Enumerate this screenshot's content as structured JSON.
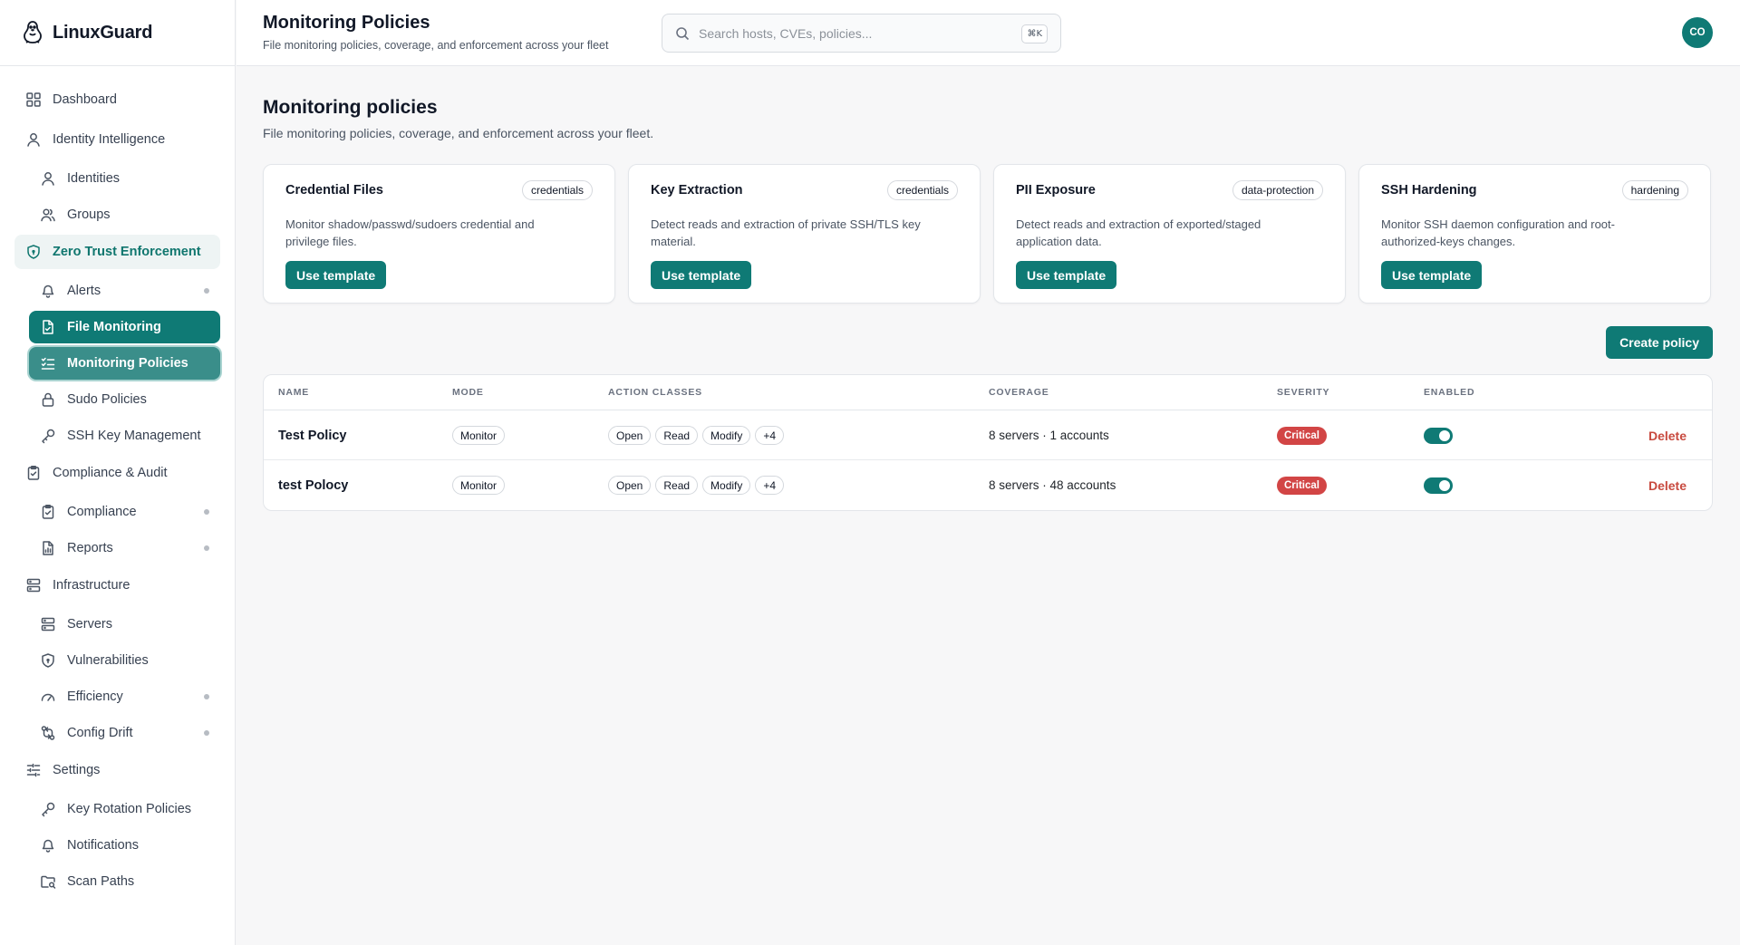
{
  "app": {
    "name": "LinuxGuard"
  },
  "sidebar": {
    "items": [
      {
        "label": "Dashboard",
        "icon": "dashboard-icon",
        "level": "top"
      },
      {
        "label": "Identity Intelligence",
        "icon": "user-icon",
        "level": "top"
      },
      {
        "label": "Identities",
        "icon": "user-icon",
        "level": "sub"
      },
      {
        "label": "Groups",
        "icon": "users-icon",
        "level": "sub"
      },
      {
        "label": "Zero Trust Enforcement",
        "icon": "shield-icon",
        "level": "top",
        "state": "section-active"
      },
      {
        "label": "Alerts",
        "icon": "bell-icon",
        "level": "sub",
        "dot": true
      },
      {
        "label": "File Monitoring",
        "icon": "file-icon",
        "level": "sub",
        "state": "active"
      },
      {
        "label": "Monitoring Policies",
        "icon": "list-check-icon",
        "level": "sub",
        "state": "active2"
      },
      {
        "label": "Sudo Policies",
        "icon": "lock-icon",
        "level": "sub"
      },
      {
        "label": "SSH Key Management",
        "icon": "key-icon",
        "level": "sub"
      },
      {
        "label": "Compliance & Audit",
        "icon": "clipboard-icon",
        "level": "top"
      },
      {
        "label": "Compliance",
        "icon": "clipboard-icon",
        "level": "sub",
        "dot": true
      },
      {
        "label": "Reports",
        "icon": "report-icon",
        "level": "sub",
        "dot": true
      },
      {
        "label": "Infrastructure",
        "icon": "server-icon",
        "level": "top"
      },
      {
        "label": "Servers",
        "icon": "server-icon",
        "level": "sub"
      },
      {
        "label": "Vulnerabilities",
        "icon": "shield-icon",
        "level": "sub"
      },
      {
        "label": "Efficiency",
        "icon": "gauge-icon",
        "level": "sub",
        "dot": true
      },
      {
        "label": "Config Drift",
        "icon": "git-compare-icon",
        "level": "sub",
        "dot": true
      },
      {
        "label": "Settings",
        "icon": "sliders-icon",
        "level": "top"
      },
      {
        "label": "Key Rotation Policies",
        "icon": "key-icon",
        "level": "sub"
      },
      {
        "label": "Notifications",
        "icon": "bell-icon",
        "level": "sub"
      },
      {
        "label": "Scan Paths",
        "icon": "folder-search-icon",
        "level": "sub"
      }
    ]
  },
  "header": {
    "title": "Monitoring Policies",
    "subtitle": "File monitoring policies, coverage, and enforcement across your fleet",
    "search_placeholder": "Search hosts, CVEs, policies...",
    "search_shortcut": "⌘K",
    "avatar_initials": "CO"
  },
  "main": {
    "title": "Monitoring policies",
    "subtitle": "File monitoring policies, coverage, and enforcement across your fleet.",
    "templates": [
      {
        "title": "Credential Files",
        "tag": "credentials",
        "description": "Monitor shadow/passwd/sudoers credential and privilege files.",
        "button": "Use template"
      },
      {
        "title": "Key Extraction",
        "tag": "credentials",
        "description": "Detect reads and extraction of private SSH/TLS key material.",
        "button": "Use template"
      },
      {
        "title": "PII Exposure",
        "tag": "data-protection",
        "description": "Detect reads and extraction of exported/staged application data.",
        "button": "Use template"
      },
      {
        "title": "SSH Hardening",
        "tag": "hardening",
        "description": "Monitor SSH daemon configuration and root-authorized-keys changes.",
        "button": "Use template"
      }
    ],
    "create_button": "Create policy",
    "table": {
      "columns": [
        "NAME",
        "MODE",
        "ACTION CLASSES",
        "COVERAGE",
        "SEVERITY",
        "ENABLED"
      ],
      "rows": [
        {
          "name": "Test Policy",
          "mode": "Monitor",
          "actions": [
            "Open",
            "Read",
            "Modify",
            "+4"
          ],
          "coverage": "8 servers · 1 accounts",
          "severity": "Critical",
          "enabled": true,
          "delete": "Delete"
        },
        {
          "name": "test Polocy",
          "mode": "Monitor",
          "actions": [
            "Open",
            "Read",
            "Modify",
            "+4"
          ],
          "coverage": "8 servers · 48 accounts",
          "severity": "Critical",
          "enabled": true,
          "delete": "Delete"
        }
      ]
    }
  },
  "colors": {
    "accent": "#0f7a75",
    "critical": "#d24545",
    "delete": "#c84a3f"
  }
}
